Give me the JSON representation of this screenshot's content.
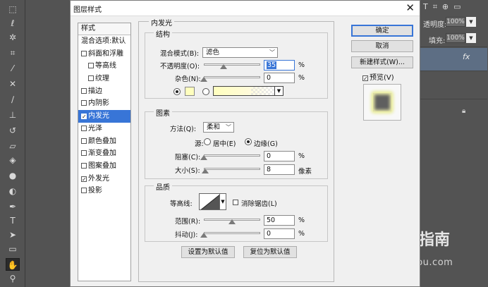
{
  "dialog": {
    "title": "图层样式",
    "close": "✕"
  },
  "styles": {
    "header": "样式",
    "blending": "混合选项:默认",
    "items": [
      {
        "label": "斜面和浮雕",
        "checked": false,
        "indent": false,
        "selected": false
      },
      {
        "label": "等高线",
        "checked": false,
        "indent": true,
        "selected": false
      },
      {
        "label": "纹理",
        "checked": false,
        "indent": true,
        "selected": false
      },
      {
        "label": "描边",
        "checked": false,
        "indent": false,
        "selected": false
      },
      {
        "label": "内阴影",
        "checked": false,
        "indent": false,
        "selected": false
      },
      {
        "label": "内发光",
        "checked": true,
        "indent": false,
        "selected": true
      },
      {
        "label": "光泽",
        "checked": false,
        "indent": false,
        "selected": false
      },
      {
        "label": "颜色叠加",
        "checked": false,
        "indent": false,
        "selected": false
      },
      {
        "label": "渐变叠加",
        "checked": false,
        "indent": false,
        "selected": false
      },
      {
        "label": "图案叠加",
        "checked": false,
        "indent": false,
        "selected": false
      },
      {
        "label": "外发光",
        "checked": true,
        "indent": false,
        "selected": false
      },
      {
        "label": "投影",
        "checked": false,
        "indent": false,
        "selected": false
      }
    ]
  },
  "panel": {
    "title": "内发光",
    "structure": {
      "title": "结构",
      "blend_mode_label": "混合模式(B):",
      "blend_mode_value": "滤色",
      "opacity_label": "不透明度(O):",
      "opacity_value": "35",
      "opacity_level": 35,
      "noise_label": "杂色(N):",
      "noise_value": "0",
      "noise_level": 0,
      "percent": "%"
    },
    "elements": {
      "title": "图素",
      "method_label": "方法(Q):",
      "method_value": "柔和",
      "source_label": "源:",
      "source_center": "居中(E)",
      "source_edge": "边缘(G)",
      "choke_label": "阻塞(C):",
      "choke_value": "0",
      "choke_level": 0,
      "size_label": "大小(S):",
      "size_value": "8",
      "size_level": 3,
      "px": "像素",
      "percent": "%"
    },
    "quality": {
      "title": "品质",
      "contour_label": "等高线:",
      "antialias_label": "消除锯齿(L)",
      "range_label": "范围(R):",
      "range_value": "50",
      "range_level": 50,
      "jitter_label": "抖动(J):",
      "jitter_value": "0",
      "jitter_level": 0,
      "percent": "%"
    },
    "set_default": "设置为默认值",
    "reset_default": "复位为默认值"
  },
  "buttons": {
    "ok": "确定",
    "cancel": "取消",
    "new_style": "新建样式(W)...",
    "preview": "预览(V)"
  },
  "colors": {
    "glow": "#ffffbe",
    "selection": "#3875d7"
  },
  "ps": {
    "opacity_label": "透明度:",
    "opacity_value": "100%",
    "fill_label": "填充:",
    "fill_value": "100%",
    "fx": "fx"
  },
  "watermark": {
    "text": "搜狗指南",
    "url": "zhinan.sogou.com"
  }
}
